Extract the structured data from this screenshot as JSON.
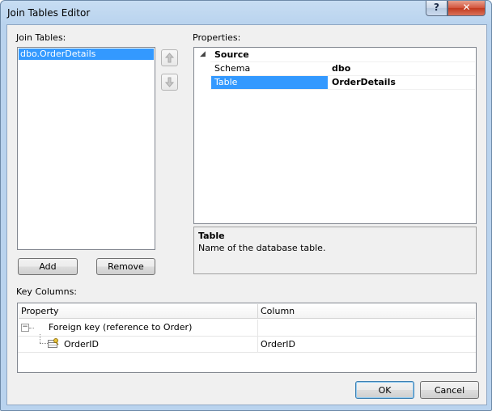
{
  "window": {
    "title": "Join Tables Editor",
    "help_label": "?",
    "close_label": "✕"
  },
  "join_tables": {
    "label": "Join Tables:",
    "items": [
      "dbo.OrderDetails"
    ],
    "add_label": "Add",
    "remove_label": "Remove"
  },
  "properties": {
    "label": "Properties:",
    "category": "Source",
    "collapse_glyph": "◢",
    "rows": [
      {
        "name": "Schema",
        "value": "dbo"
      },
      {
        "name": "Table",
        "value": "OrderDetails"
      }
    ],
    "description_title": "Table",
    "description_text": "Name of the database table."
  },
  "key_columns": {
    "label": "Key Columns:",
    "headers": {
      "property": "Property",
      "column": "Column"
    },
    "group": {
      "expander": "−",
      "label": "Foreign key (reference to Order)"
    },
    "rows": [
      {
        "property": "OrderID",
        "column": "OrderID"
      }
    ]
  },
  "footer": {
    "ok_label": "OK",
    "cancel_label": "Cancel"
  },
  "colors": {
    "selection": "#3399ff",
    "title_bar": "#b9d3ee",
    "close_button": "#c23a1e"
  }
}
